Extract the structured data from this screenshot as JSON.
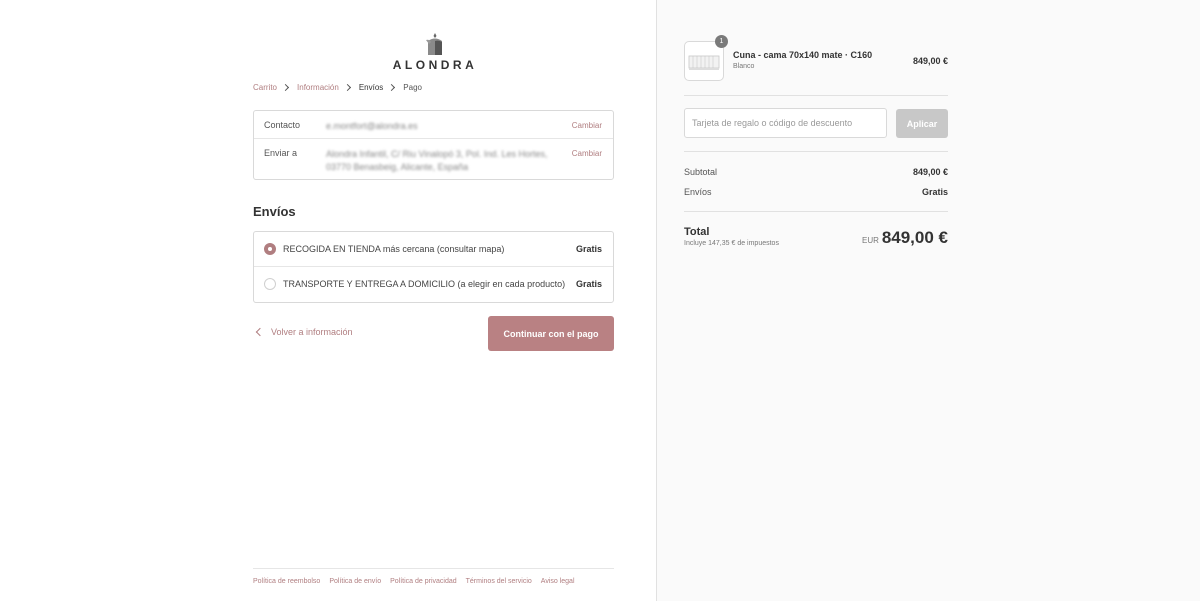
{
  "brand": {
    "logo_text": "ALONDRA"
  },
  "breadcrumb": {
    "items": [
      {
        "label": "Carrito"
      },
      {
        "label": "Información"
      },
      {
        "label": "Envíos"
      },
      {
        "label": "Pago"
      }
    ]
  },
  "review": {
    "contact": {
      "label": "Contacto",
      "value": "e.montfort@alondra.es",
      "change": "Cambiar"
    },
    "ship_to": {
      "label": "Enviar a",
      "value": "Alondra Infantil, C/ Riu Vinalopó 3, Pol. Ind. Les Hortes, 03770 Benasbeig, Alicante, España",
      "change": "Cambiar"
    }
  },
  "shipping": {
    "title": "Envíos",
    "options": [
      {
        "label": "RECOGIDA EN TIENDA más cercana (consultar mapa)",
        "price": "Gratis",
        "selected": true
      },
      {
        "label": "TRANSPORTE Y ENTREGA A DOMICILIO (a elegir en cada producto)",
        "price": "Gratis",
        "selected": false
      }
    ]
  },
  "actions": {
    "back": "Volver a información",
    "continue": "Continuar con el pago"
  },
  "footer": {
    "links": [
      "Política de reembolso",
      "Política de envío",
      "Política de privacidad",
      "Términos del servicio",
      "Aviso legal"
    ]
  },
  "order": {
    "product": {
      "name": "Cuna - cama 70x140 mate · C160",
      "variant": "Blanco",
      "price": "849,00 €",
      "quantity": "1"
    },
    "discount": {
      "placeholder": "Tarjeta de regalo o código de descuento",
      "apply": "Aplicar"
    },
    "subtotal": {
      "label": "Subtotal",
      "value": "849,00 €"
    },
    "shipping": {
      "label": "Envíos",
      "value": "Gratis"
    },
    "total": {
      "label": "Total",
      "tax_note": "Incluye 147,35 € de impuestos",
      "currency": "EUR",
      "value": "849,00 €"
    }
  },
  "colors": {
    "accent": "#b98183",
    "link": "#b07e80",
    "sidebar_bg": "#fafafa"
  }
}
